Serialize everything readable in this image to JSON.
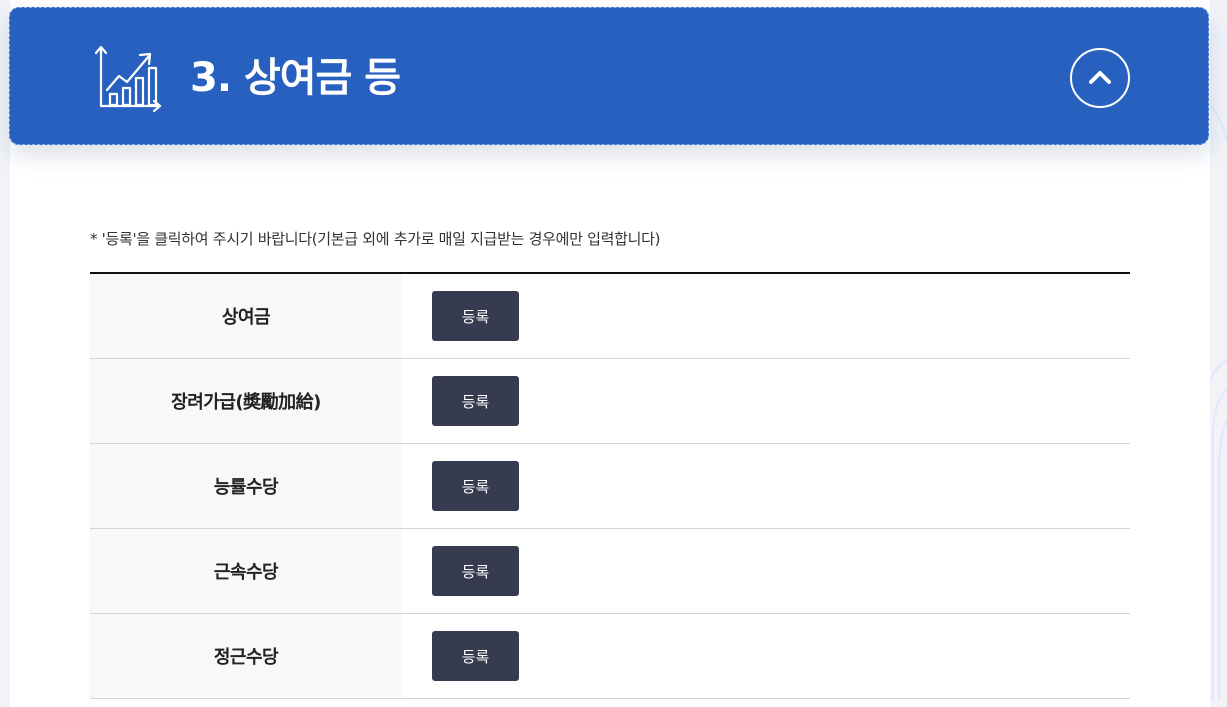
{
  "section": {
    "title": "3. 상여금 등",
    "icon": "chart-growth-icon",
    "collapse_icon": "chevron-up-icon"
  },
  "notice": "* '등록'을 클릭하여 주시기 바랍니다(기본급 외에 추가로 매일 지급받는 경우에만 입력합니다)",
  "rows": [
    {
      "label": "상여금",
      "button_label": "등록"
    },
    {
      "label": "장려가급(奬勵加給)",
      "button_label": "등록"
    },
    {
      "label": "능률수당",
      "button_label": "등록"
    },
    {
      "label": "근속수당",
      "button_label": "등록"
    },
    {
      "label": "정근수당",
      "button_label": "등록"
    }
  ],
  "colors": {
    "header_bg": "#2860c0",
    "button_bg": "#363b4f",
    "label_cell_bg": "#f7f8f8"
  }
}
